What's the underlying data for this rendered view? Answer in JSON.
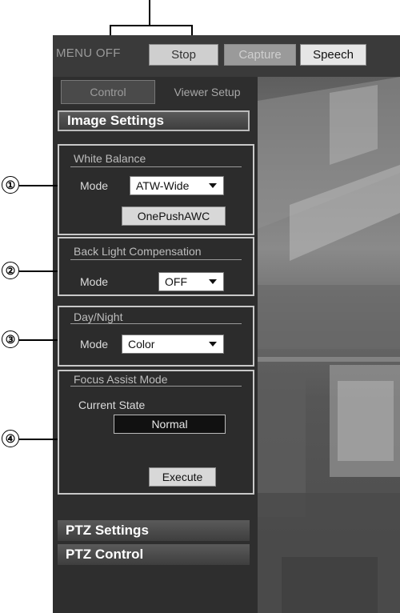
{
  "toolbar": {
    "menu_off": "MENU OFF",
    "stop": "Stop",
    "capture": "Capture",
    "speech": "Speech"
  },
  "tabs": {
    "control": "Control",
    "viewer_setup": "Viewer Setup"
  },
  "image_settings": {
    "title": "Image Settings",
    "white_balance": {
      "title": "White Balance",
      "mode_label": "Mode",
      "mode_value": "ATW-Wide",
      "button": "OnePushAWC"
    },
    "back_light": {
      "title": "Back Light Compensation",
      "mode_label": "Mode",
      "mode_value": "OFF"
    },
    "day_night": {
      "title": "Day/Night",
      "mode_label": "Mode",
      "mode_value": "Color"
    },
    "focus_assist": {
      "title": "Focus Assist Mode",
      "state_label": "Current State",
      "state_value": "Normal",
      "button": "Execute"
    }
  },
  "ptz_settings": "PTZ Settings",
  "ptz_control": "PTZ Control",
  "callouts": [
    "①",
    "②",
    "③",
    "④"
  ],
  "colors": {
    "panel": "#2e2e2e",
    "toolbar": "#3a3a3a",
    "group_border": "#c8c8c8"
  }
}
